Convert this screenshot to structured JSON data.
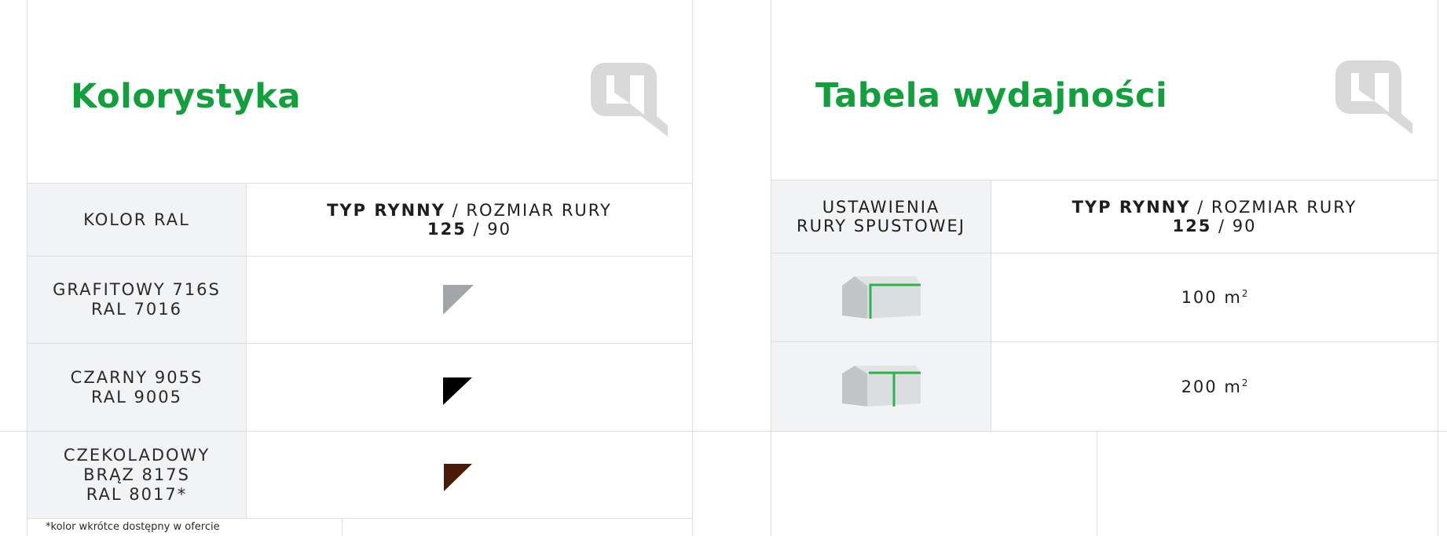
{
  "colors": {
    "brand_green": "#12a03c",
    "grid": "#dcdee2",
    "cell_gray": "#f2f3f5",
    "logo_gray": "#d9d9d9"
  },
  "colors_panel": {
    "title": "Kolorystyka",
    "logo_icon": "q-logo-icon",
    "header": {
      "col1": "KOLOR RAL",
      "col2_bold_1": "TYP RYNNY",
      "col2_sep_1": " / ",
      "col2_text_1": "ROZMIAR RURY",
      "col2_bold_2": "125",
      "col2_sep_2": " / ",
      "col2_text_2": "90"
    },
    "rows": [
      {
        "name": "GRAFITOWY 716S",
        "ral": "RAL 7016",
        "swatch": "#a2a6ab"
      },
      {
        "name": "CZARNY 905S",
        "ral": "RAL 9005",
        "swatch": "#000000"
      },
      {
        "name_1": "CZEKOLADOWY",
        "name_2": "BRĄZ 817S",
        "ral": "RAL 8017*",
        "swatch": "#4a1b06"
      }
    ],
    "footnote": "*kolor wkrótce dostępny w ofercie"
  },
  "efficiency_panel": {
    "title": "Tabela wydajności",
    "logo_icon": "q-logo-icon",
    "header": {
      "col1_line1": "USTAWIENIA",
      "col1_line2": "RURY SPUSTOWEJ",
      "col2_bold_1": "TYP RYNNY",
      "col2_sep_1": " / ",
      "col2_text_1": "ROZMIAR RURY",
      "col2_bold_2": "125",
      "col2_sep_2": " / ",
      "col2_text_2": "90"
    },
    "rows": [
      {
        "icon": "house-corner-downpipe-icon",
        "value": "100 m",
        "unit_sup": "2"
      },
      {
        "icon": "house-center-downpipe-icon",
        "value": "200 m",
        "unit_sup": "2"
      }
    ]
  }
}
